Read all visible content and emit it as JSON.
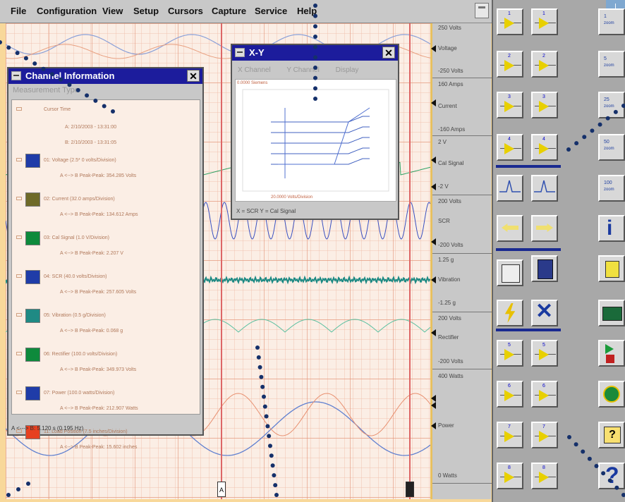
{
  "menu": {
    "items": [
      "File",
      "Configuration",
      "View",
      "Setup",
      "Cursors",
      "Capture",
      "Service",
      "Help"
    ]
  },
  "scale": {
    "labels": [
      {
        "text": "250 Volts"
      },
      {
        "text": "Voltage"
      },
      {
        "text": "-250 Volts"
      },
      {
        "text": "160 Amps"
      },
      {
        "text": "Current"
      },
      {
        "text": "-160 Amps"
      },
      {
        "text": "2 V"
      },
      {
        "text": "Cal Signal"
      },
      {
        "text": "-2 V"
      },
      {
        "text": "200 Volts"
      },
      {
        "text": "SCR"
      },
      {
        "text": "-200 Volts"
      },
      {
        "text": "1.25 g"
      },
      {
        "text": "Vibration"
      },
      {
        "text": "-1.25 g"
      },
      {
        "text": "200 Volts"
      },
      {
        "text": "Rectifier"
      },
      {
        "text": "-200 Volts"
      },
      {
        "text": "400 Watts"
      },
      {
        "text": "Power"
      },
      {
        "text": "0 Watts"
      }
    ]
  },
  "cursors": {
    "a_label": "A",
    "b_label": "B"
  },
  "channel_window": {
    "title": "Channel Information",
    "subheader": "Measurement Type",
    "cursor_time_label": "Cursor Time",
    "cursor_a_time": "A: 2/10/2003 - 13:31:00",
    "cursor_b_time": "B: 2/10/2003 - 13:31:05",
    "channels": [
      {
        "name": "01: Voltage (2.5* 0 volts/Division)",
        "measure": "A <--> B Peak-Peak: 354.285 Volts",
        "color": "#1f3ca8"
      },
      {
        "name": "02: Current (32.0 amps/Division)",
        "measure": "A <--> B Peak-Peak: 134.612 Amps",
        "color": "#6e6a28"
      },
      {
        "name": "03: Cal Signal (1.0 V/Division)",
        "measure": "A <--> B Peak-Peak: 2.207 V",
        "color": "#0e8a3c"
      },
      {
        "name": "04: SCR (40.0 volts/Division)",
        "measure": "A <--> B Peak-Peak: 257.605 Volts",
        "color": "#1f3ca8"
      },
      {
        "name": "05: Vibration (0.5 g/Division)",
        "measure": "A <--> B Peak-Peak: 0.068 g",
        "color": "#1f8a84"
      },
      {
        "name": "06: Rectifier (100.0 volts/Division)",
        "measure": "A <--> B Peak-Peak: 349.973 Volts",
        "color": "#0e8a3c"
      },
      {
        "name": "07: Power (100.0 watts/Division)",
        "measure": "A <--> B Peak-Peak: 212.907 Watts",
        "color": "#1f3ca8"
      },
      {
        "name": "11: Load Position (7.5 inches/Division)",
        "measure": "A <--> B Peak-Peak: 15.602 inches",
        "color": "#e64020"
      }
    ],
    "status": "A <---> B: 5.120 s (0.195 Hz)"
  },
  "xy_window": {
    "title": "X-Y",
    "menu": [
      "X Channel",
      "Y Channel",
      "Display"
    ],
    "top_label": "0.0000 Siemens",
    "bottom_label": "20.0000 Volts/Division",
    "status": "X = SCR   Y = Cal Signal"
  },
  "toolbar": {
    "top_badge": "I",
    "amp_buttons": [
      "1",
      "1",
      "2",
      "2",
      "3",
      "3",
      "4",
      "4",
      "5",
      "5",
      "6",
      "6",
      "7",
      "7",
      "8",
      "8"
    ],
    "zoom_labels": [
      "zoom",
      "zoom",
      "zoom",
      "zoom",
      "zoom"
    ],
    "zoom_values": [
      "1",
      "5",
      "25",
      "50",
      "100"
    ],
    "help_glyph": "?",
    "info_glyph": "i"
  }
}
